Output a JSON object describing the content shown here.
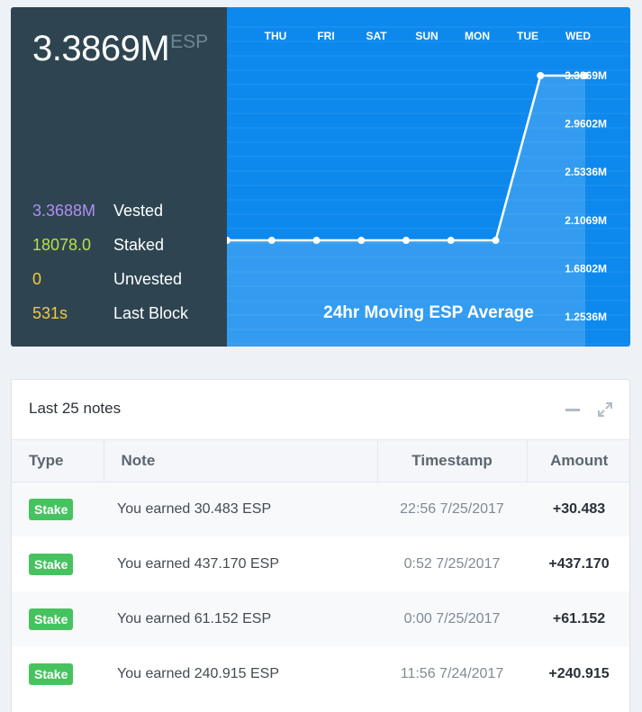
{
  "balance": {
    "value": "3.3869M",
    "unit": "ESP"
  },
  "stats": [
    {
      "value": "3.3688M",
      "label": "Vested",
      "color": "#b08ef0"
    },
    {
      "value": "18078.0",
      "label": "Staked",
      "color": "#b7e04a"
    },
    {
      "value": "0",
      "label": "Unvested",
      "color": "#f5c93b"
    },
    {
      "value": "531s",
      "label": "Last Block",
      "color": "#f5c93b"
    }
  ],
  "chart_data": {
    "type": "line",
    "title": "24hr Moving ESP Average",
    "days": [
      "THU",
      "FRI",
      "SAT",
      "SUN",
      "MON",
      "TUE",
      "WED"
    ],
    "y_ticks": [
      "3.3869M",
      "2.9602M",
      "2.5336M",
      "2.1069M",
      "1.6802M",
      "1.2536M"
    ],
    "ylim": [
      1.2536,
      3.3869
    ],
    "series": [
      {
        "x": [
          0,
          1,
          2,
          3,
          4,
          5,
          6,
          7,
          8
        ],
        "y": [
          1.93,
          1.93,
          1.93,
          1.93,
          1.93,
          1.93,
          1.93,
          3.3869,
          3.3869
        ]
      }
    ]
  },
  "notes": {
    "title": "Last 25 notes",
    "columns": [
      "Type",
      "Note",
      "Timestamp",
      "Amount"
    ],
    "rows": [
      {
        "type": "Stake",
        "note": "You earned 30.483 ESP",
        "timestamp": "22:56 7/25/2017",
        "amount": "+30.483"
      },
      {
        "type": "Stake",
        "note": "You earned 437.170 ESP",
        "timestamp": "0:52 7/25/2017",
        "amount": "+437.170"
      },
      {
        "type": "Stake",
        "note": "You earned 61.152 ESP",
        "timestamp": "0:00 7/25/2017",
        "amount": "+61.152"
      },
      {
        "type": "Stake",
        "note": "You earned 240.915 ESP",
        "timestamp": "11:56 7/24/2017",
        "amount": "+240.915"
      }
    ]
  }
}
